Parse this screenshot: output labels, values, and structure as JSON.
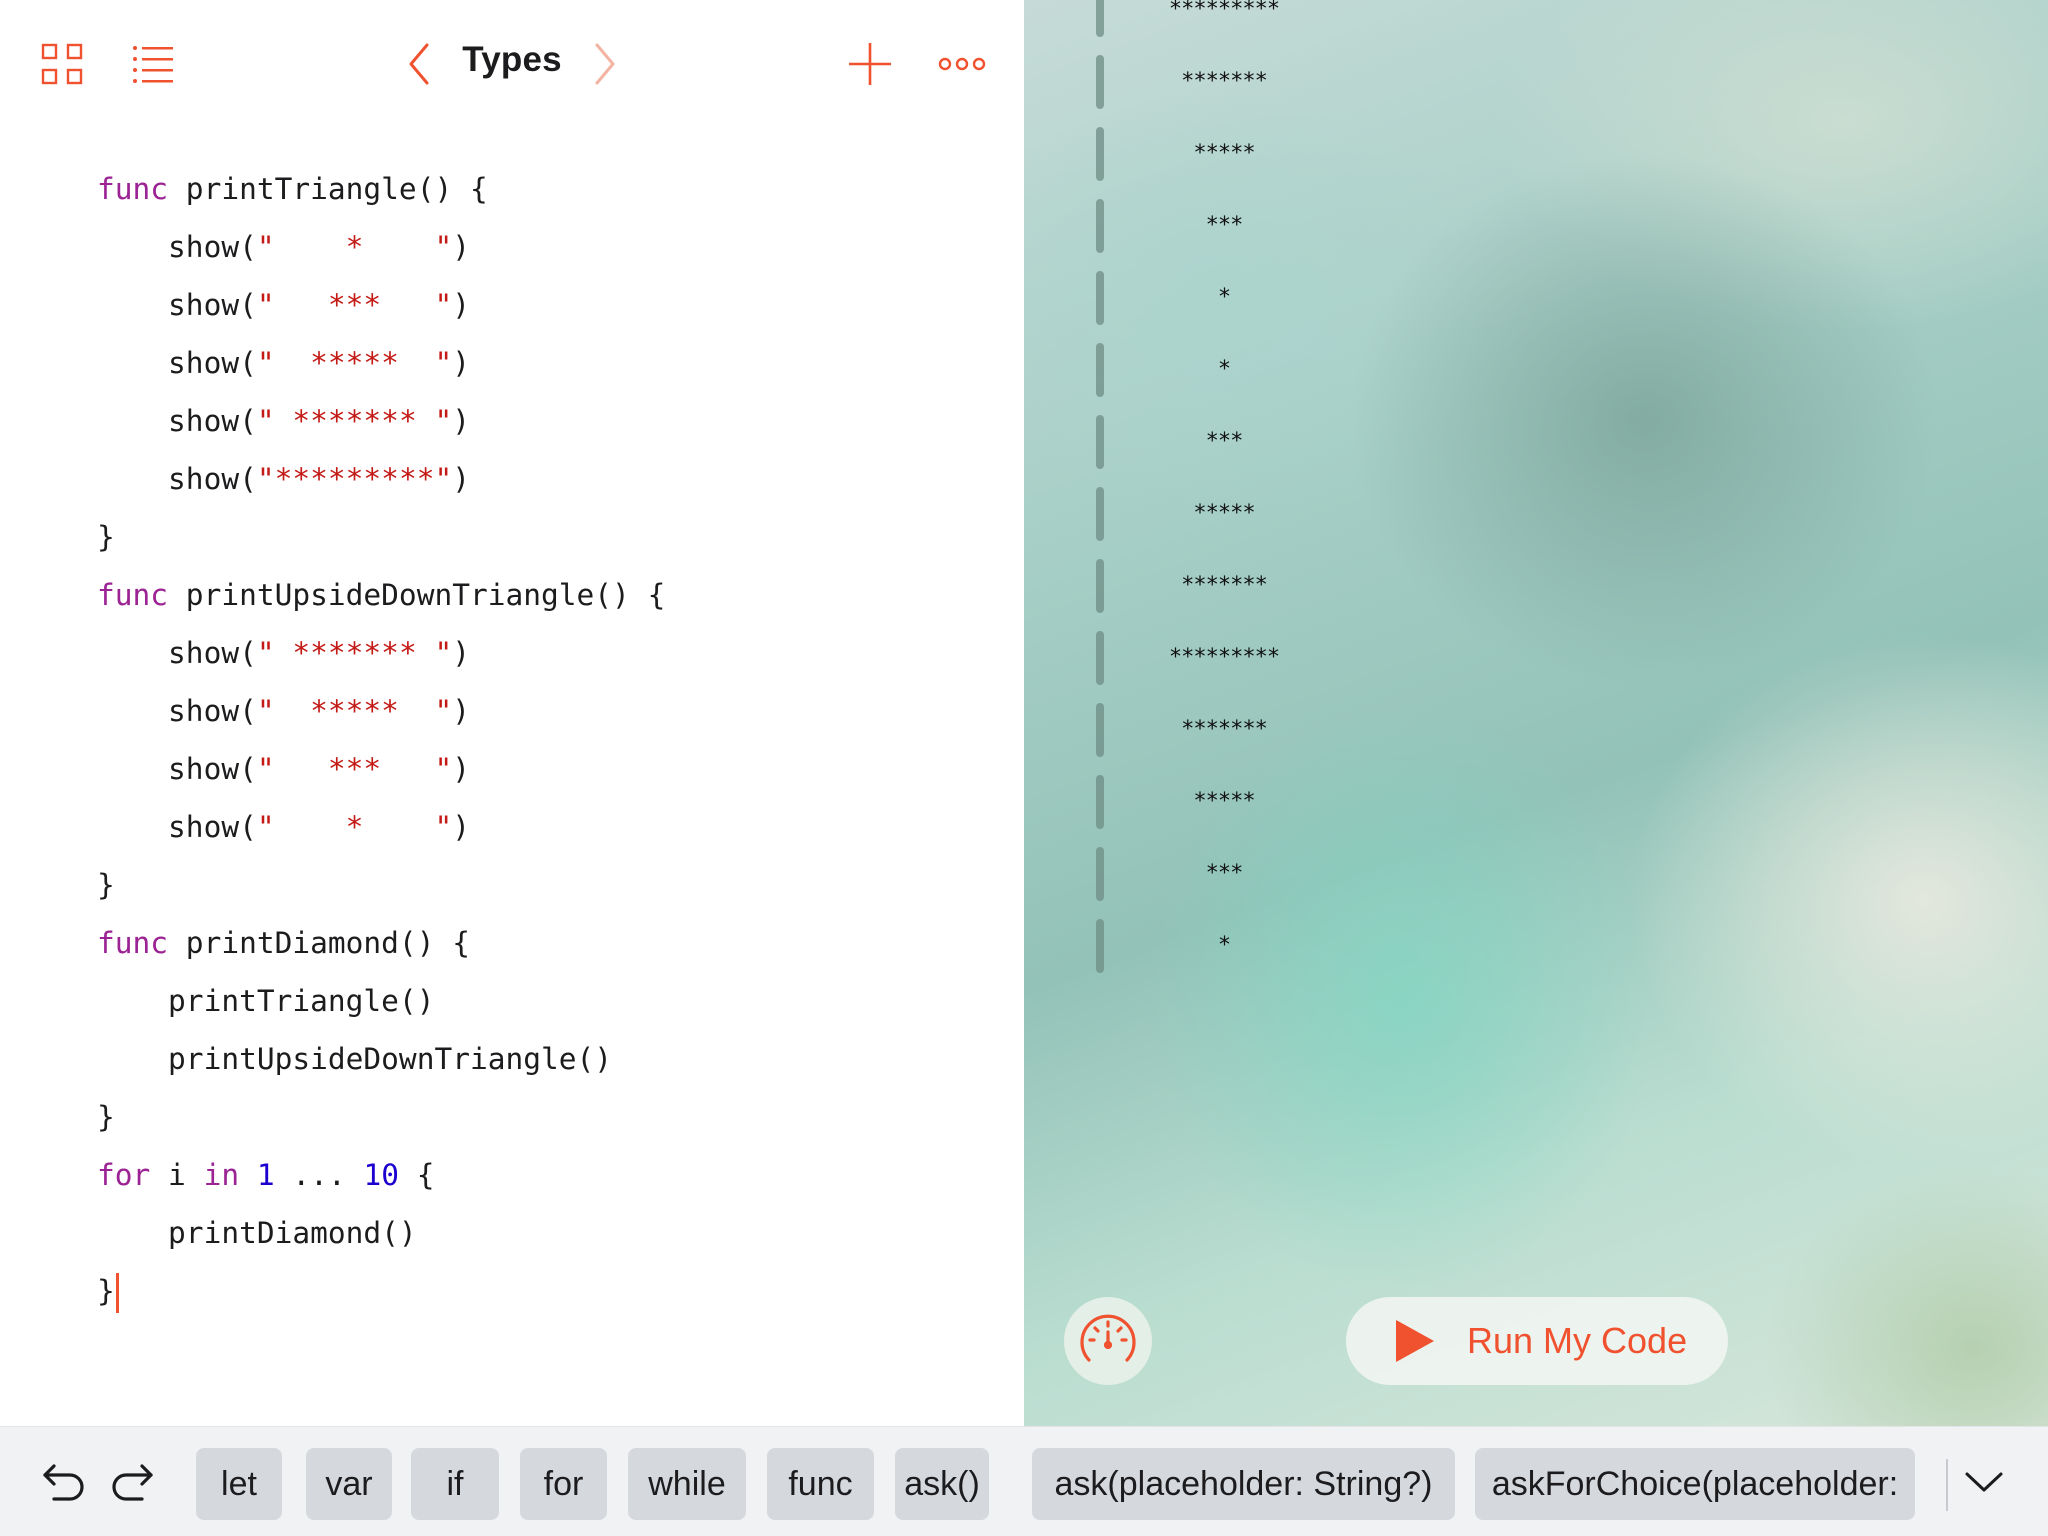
{
  "navbar": {
    "title": "Types",
    "icons": [
      "grid-icon",
      "list-icon",
      "back-chevron-icon",
      "forward-chevron-icon",
      "plus-icon",
      "more-icon"
    ]
  },
  "editor": {
    "lines": [
      [
        {
          "t": "func",
          "c": "kw"
        },
        {
          "t": " printTriangle() {",
          "c": ""
        }
      ],
      [
        {
          "t": "    show(",
          "c": ""
        },
        {
          "t": "\"    *    \"",
          "c": "str"
        },
        {
          "t": ")",
          "c": ""
        }
      ],
      [
        {
          "t": "    show(",
          "c": ""
        },
        {
          "t": "\"   ***   \"",
          "c": "str"
        },
        {
          "t": ")",
          "c": ""
        }
      ],
      [
        {
          "t": "    show(",
          "c": ""
        },
        {
          "t": "\"  *****  \"",
          "c": "str"
        },
        {
          "t": ")",
          "c": ""
        }
      ],
      [
        {
          "t": "    show(",
          "c": ""
        },
        {
          "t": "\" ******* \"",
          "c": "str"
        },
        {
          "t": ")",
          "c": ""
        }
      ],
      [
        {
          "t": "    show(",
          "c": ""
        },
        {
          "t": "\"*********\"",
          "c": "str"
        },
        {
          "t": ")",
          "c": ""
        }
      ],
      [
        {
          "t": "}",
          "c": ""
        }
      ],
      [
        {
          "t": "func",
          "c": "kw"
        },
        {
          "t": " printUpsideDownTriangle() {",
          "c": ""
        }
      ],
      [
        {
          "t": "    show(",
          "c": ""
        },
        {
          "t": "\" ******* \"",
          "c": "str"
        },
        {
          "t": ")",
          "c": ""
        }
      ],
      [
        {
          "t": "    show(",
          "c": ""
        },
        {
          "t": "\"  *****  \"",
          "c": "str"
        },
        {
          "t": ")",
          "c": ""
        }
      ],
      [
        {
          "t": "    show(",
          "c": ""
        },
        {
          "t": "\"   ***   \"",
          "c": "str"
        },
        {
          "t": ")",
          "c": ""
        }
      ],
      [
        {
          "t": "    show(",
          "c": ""
        },
        {
          "t": "\"    *    \"",
          "c": "str"
        },
        {
          "t": ")",
          "c": ""
        }
      ],
      [
        {
          "t": "}",
          "c": ""
        }
      ],
      [
        {
          "t": "func",
          "c": "kw"
        },
        {
          "t": " printDiamond() {",
          "c": ""
        }
      ],
      [
        {
          "t": "    printTriangle()",
          "c": ""
        }
      ],
      [
        {
          "t": "    printUpsideDownTriangle()",
          "c": ""
        }
      ],
      [
        {
          "t": "}",
          "c": ""
        }
      ],
      [
        {
          "t": "for",
          "c": "kw"
        },
        {
          "t": " i ",
          "c": ""
        },
        {
          "t": "in",
          "c": "kw"
        },
        {
          "t": " ",
          "c": ""
        },
        {
          "t": "1",
          "c": "num"
        },
        {
          "t": " ... ",
          "c": ""
        },
        {
          "t": "10",
          "c": "num"
        },
        {
          "t": " {",
          "c": ""
        }
      ],
      [
        {
          "t": "    printDiamond()",
          "c": ""
        }
      ],
      [
        {
          "t": "}",
          "c": ""
        }
      ]
    ],
    "colors": {
      "keyword": "#9b2393",
      "string": "#c41a16",
      "number": "#1c00cf",
      "caret": "#f0512e"
    }
  },
  "liveview": {
    "output_lines": [
      "*********",
      "*******",
      "*****",
      "***",
      "*",
      "*",
      "***",
      "*****",
      "*******",
      "*********",
      "*******",
      "*****",
      "***",
      "*"
    ],
    "run_button_label": "Run My Code",
    "accent": "#f0512e"
  },
  "shortcut_bar": {
    "keys": [
      "let",
      "var",
      "if",
      "for",
      "while",
      "func",
      "ask()",
      "ask(placeholder: String?)",
      "askForChoice(placeholder:"
    ]
  }
}
